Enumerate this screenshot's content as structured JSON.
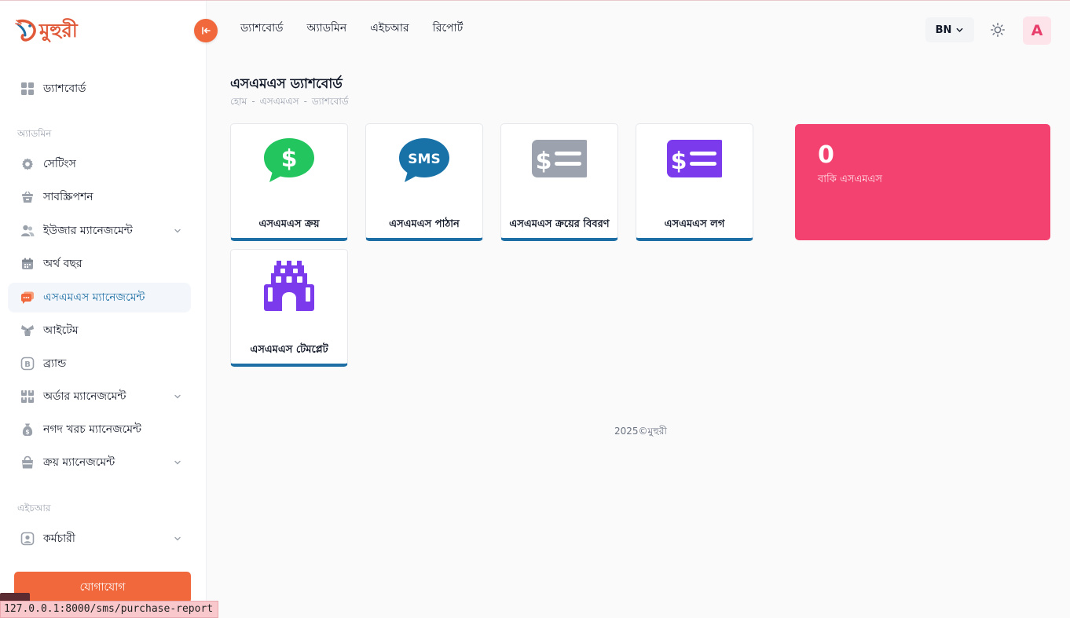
{
  "brand": {
    "name": "মুহুরী"
  },
  "topnav": [
    {
      "label": "ড্যাশবোর্ড"
    },
    {
      "label": "অ্যাডমিন"
    },
    {
      "label": "এইচআর"
    },
    {
      "label": "রিপোর্ট"
    }
  ],
  "header": {
    "lang": "BN",
    "avatar": "A"
  },
  "sidebar": {
    "dashboard": "ড্যাশবোর্ড",
    "admin_title": "অ্যাডমিন",
    "items": [
      {
        "label": "সেটিংস",
        "icon": "gear-icon"
      },
      {
        "label": "সাবস্ক্রিপশন",
        "icon": "basket-icon"
      },
      {
        "label": "ইউজার ম্যানেজমেন্ট",
        "icon": "users-icon"
      },
      {
        "label": "অর্থ বছর",
        "icon": "calendar-icon"
      },
      {
        "label": "এসএমএস ম্যানেজমেন্ট",
        "icon": "sms-chat-icon"
      },
      {
        "label": "আইটেম",
        "icon": "items-icon"
      },
      {
        "label": "ব্র্যান্ড",
        "icon": "brand-icon"
      },
      {
        "label": "অর্ডার ম্যানেজমেন্ট",
        "icon": "orders-icon"
      },
      {
        "label": "নগদ খরচ ম্যানেজমেন্ট",
        "icon": "cash-bag-icon"
      },
      {
        "label": "ক্রয় ম্যানেজমেন্ট",
        "icon": "shopping-bag-icon"
      }
    ],
    "hr_title": "এইচআর",
    "employee": "কর্মচারী",
    "contact": "যোগাযোগ"
  },
  "page": {
    "title": "এসএমএস ড্যাশবোর্ড",
    "breadcrumb": [
      "হোম",
      "এসএমএস",
      "ড্যাশবোর্ড"
    ]
  },
  "cards": [
    {
      "label": "এসএমএস ক্রয়",
      "icon": "dollar-chat-icon",
      "color": "#22c55e"
    },
    {
      "label": "এসএমএস পাঠান",
      "icon": "sms-bubble-icon",
      "color": "#1872a8"
    },
    {
      "label": "এসএমএস ক্রয়ের বিবরণ",
      "icon": "money-list-icon",
      "color": "#9ca3af"
    },
    {
      "label": "এসএমএস লগ",
      "icon": "money-log-icon",
      "color": "#7c3aed"
    },
    {
      "label": "এসএমএস টেমপ্লেট",
      "icon": "template-building-icon",
      "color": "#7c3aed"
    }
  ],
  "stat": {
    "value": "0",
    "caption": "বাকি এসএমএস",
    "color": "#f44270"
  },
  "footer": {
    "text": "2025©মুহুরী"
  },
  "status_url": "127.0.0.1:8000/sms/purchase-report"
}
